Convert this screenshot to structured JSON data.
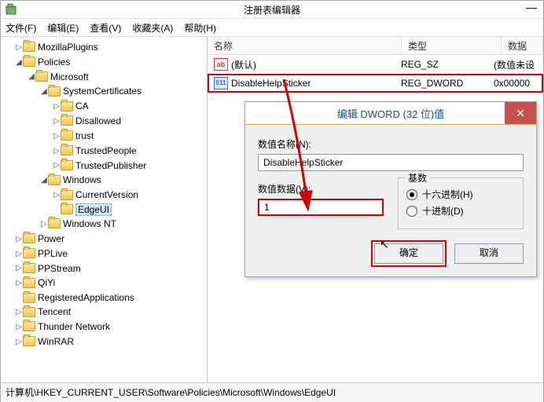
{
  "window": {
    "title": "注册表编辑器",
    "minimize": "—"
  },
  "menu": [
    "文件(F)",
    "编辑(E)",
    "查看(V)",
    "收藏夹(A)",
    "帮助(H)"
  ],
  "tree": {
    "items": [
      {
        "label": "MozillaPlugins",
        "expand": "▷"
      },
      {
        "label": "Policies",
        "expand": "◢",
        "children": [
          {
            "label": "Microsoft",
            "expand": "◢",
            "children": [
              {
                "label": "SystemCertificates",
                "expand": "◢",
                "children": [
                  {
                    "label": "CA",
                    "expand": "▷"
                  },
                  {
                    "label": "Disallowed",
                    "expand": "▷"
                  },
                  {
                    "label": "trust",
                    "expand": "▷"
                  },
                  {
                    "label": "TrustedPeople",
                    "expand": "▷"
                  },
                  {
                    "label": "TrustedPublisher",
                    "expand": "▷"
                  }
                ]
              },
              {
                "label": "Windows",
                "expand": "◢",
                "children": [
                  {
                    "label": "CurrentVersion",
                    "expand": "▷"
                  },
                  {
                    "label": "EdgeUI",
                    "selected": true
                  }
                ]
              },
              {
                "label": "Windows NT",
                "expand": "▷"
              }
            ]
          }
        ]
      },
      {
        "label": "Power",
        "expand": "▷"
      },
      {
        "label": "PPLive",
        "expand": "▷"
      },
      {
        "label": "PPStream",
        "expand": "▷"
      },
      {
        "label": "QiYi",
        "expand": "▷"
      },
      {
        "label": "RegisteredApplications"
      },
      {
        "label": "Tencent",
        "expand": "▷"
      },
      {
        "label": "Thunder Network",
        "expand": "▷"
      },
      {
        "label": "WinRAR",
        "expand": "▷"
      }
    ]
  },
  "columns": {
    "name": "名称",
    "type": "类型",
    "data": "数据"
  },
  "rows": [
    {
      "icon": "ab",
      "name": "(默认)",
      "type": "REG_SZ",
      "data": "(数值未设"
    },
    {
      "icon": "dw",
      "name": "DisableHelpSticker",
      "type": "REG_DWORD",
      "data": "0x00000",
      "hi": true
    }
  ],
  "dialog": {
    "title": "编辑 DWORD (32 位)值",
    "name_lbl": "数值名称(N):",
    "name_val": "DisableHelpSticker",
    "data_lbl": "数值数据(V):",
    "data_val": "1",
    "base_lbl": "基数",
    "hex": "十六进制(H)",
    "dec": "十进制(D)",
    "ok": "确定",
    "cancel": "取消"
  },
  "statusbar": "计算机\\HKEY_CURRENT_USER\\Software\\Policies\\Microsoft\\Windows\\EdgeUI"
}
